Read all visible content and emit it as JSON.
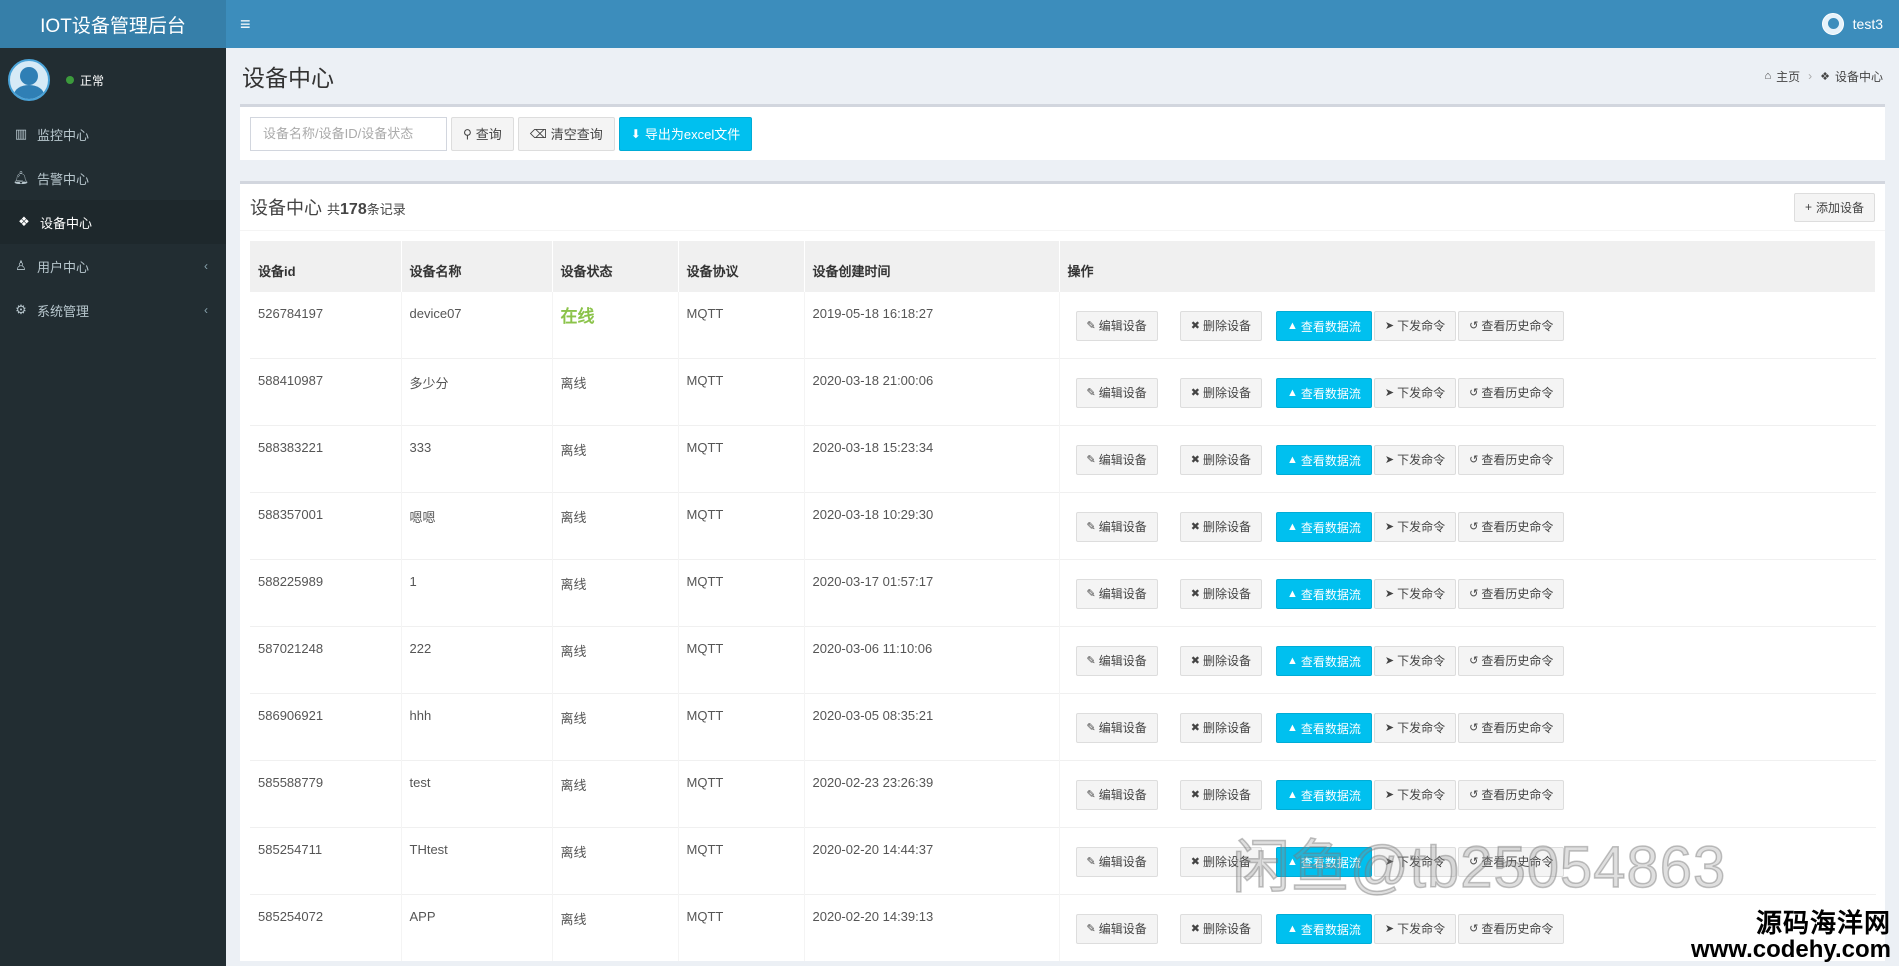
{
  "app": {
    "title": "IOT设备管理后台"
  },
  "header": {
    "menu_icon": "bars-icon",
    "user_name": "test3"
  },
  "sidebar": {
    "status": "正常",
    "items": [
      {
        "label": "监控中心",
        "icon": "bar-chart-icon",
        "active": false,
        "has_caret": false
      },
      {
        "label": "告警中心",
        "icon": "bell-icon",
        "active": false,
        "has_caret": false
      },
      {
        "label": "设备中心",
        "icon": "cubes-icon",
        "active": true,
        "has_caret": false
      },
      {
        "label": "用户中心",
        "icon": "user-icon",
        "active": false,
        "has_caret": true
      },
      {
        "label": "系统管理",
        "icon": "gear-icon",
        "active": false,
        "has_caret": true
      }
    ]
  },
  "page": {
    "title": "设备中心",
    "breadcrumb": [
      "主页",
      "设备中心"
    ]
  },
  "search": {
    "placeholder": "设备名称/设备ID/设备状态",
    "query_label": "查询",
    "clear_label": "清空查询",
    "export_label": "导出为excel文件"
  },
  "table_box": {
    "title": "设备中心",
    "count_prefix": "共",
    "count": "178",
    "count_suffix": "条记录",
    "add_label": "添加设备"
  },
  "table": {
    "columns": [
      "设备id",
      "设备名称",
      "设备状态",
      "设备协议",
      "设备创建时间",
      "操作"
    ],
    "rows": [
      {
        "id": "526784197",
        "name": "device07",
        "status": "在线",
        "protocol": "MQTT",
        "created": "2019-05-18 16:18:27"
      },
      {
        "id": "588410987",
        "name": "多少分",
        "status": "离线",
        "protocol": "MQTT",
        "created": "2020-03-18 21:00:06"
      },
      {
        "id": "588383221",
        "name": "333",
        "status": "离线",
        "protocol": "MQTT",
        "created": "2020-03-18 15:23:34"
      },
      {
        "id": "588357001",
        "name": "嗯嗯",
        "status": "离线",
        "protocol": "MQTT",
        "created": "2020-03-18 10:29:30"
      },
      {
        "id": "588225989",
        "name": "1",
        "status": "离线",
        "protocol": "MQTT",
        "created": "2020-03-17 01:57:17"
      },
      {
        "id": "587021248",
        "name": "222",
        "status": "离线",
        "protocol": "MQTT",
        "created": "2020-03-06 11:10:06"
      },
      {
        "id": "586906921",
        "name": "hhh",
        "status": "离线",
        "protocol": "MQTT",
        "created": "2020-03-05 08:35:21"
      },
      {
        "id": "585588779",
        "name": "test",
        "status": "离线",
        "protocol": "MQTT",
        "created": "2020-02-23 23:26:39"
      },
      {
        "id": "585254711",
        "name": "THtest",
        "status": "离线",
        "protocol": "MQTT",
        "created": "2020-02-20 14:44:37"
      },
      {
        "id": "585254072",
        "name": "APP",
        "status": "离线",
        "protocol": "MQTT",
        "created": "2020-02-20 14:39:13"
      }
    ],
    "actions": {
      "edit": "编辑设备",
      "delete": "删除设备",
      "data": "查看数据流",
      "command": "下发命令",
      "history": "查看历史命令"
    }
  },
  "overlay": {
    "watermark": "闲鱼@tb25054863",
    "site_cn": "源码海洋网",
    "site_url": "www.codehy.com"
  },
  "colors": {
    "header": "#3c8dbc",
    "logo": "#367fa9",
    "sidebar": "#222d32",
    "info": "#00c0ef",
    "online": "#8bc34a"
  }
}
